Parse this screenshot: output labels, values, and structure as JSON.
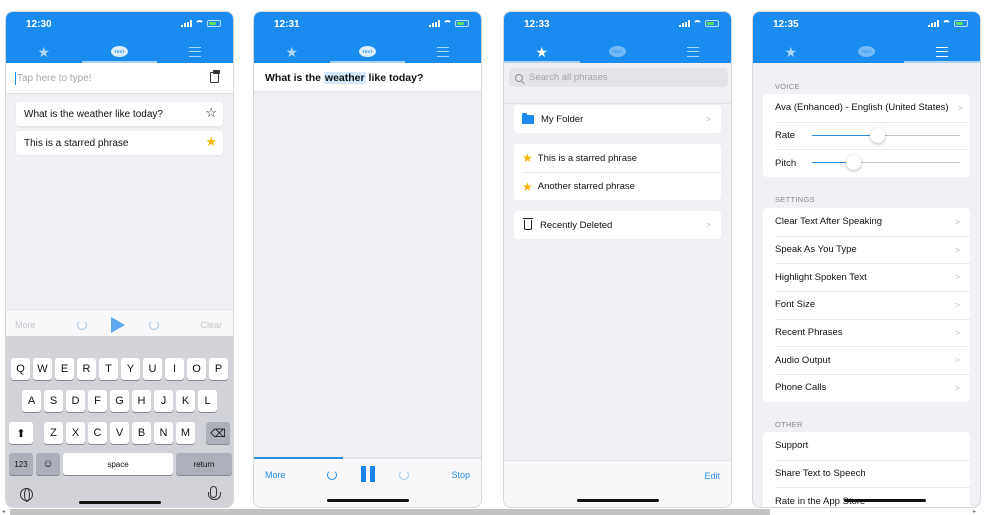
{
  "brand_color": "#1a8cf0",
  "screens": [
    {
      "time": "12:30",
      "active_tab": "text",
      "input_placeholder": "Tap here to type!",
      "phrases": [
        {
          "text": "What is the weather like today?",
          "starred": false
        },
        {
          "text": "This is a starred phrase",
          "starred": true
        }
      ],
      "controls": {
        "more": "More",
        "clear": "Clear"
      },
      "keyboard": {
        "row1": [
          "Q",
          "W",
          "E",
          "R",
          "T",
          "Y",
          "U",
          "I",
          "O",
          "P"
        ],
        "row2": [
          "A",
          "S",
          "D",
          "F",
          "G",
          "H",
          "J",
          "K",
          "L"
        ],
        "row3": [
          "Z",
          "X",
          "C",
          "V",
          "B",
          "N",
          "M"
        ],
        "num_key": "123",
        "space_key": "space",
        "return_key": "return"
      }
    },
    {
      "time": "12:31",
      "active_tab": "text",
      "speaking_text_before": "What is the ",
      "speaking_text_highlight": "weather",
      "speaking_text_after": " like today?",
      "progress": 0.39,
      "controls": {
        "more": "More",
        "stop": "Stop"
      }
    },
    {
      "time": "12:33",
      "active_tab": "starred",
      "search_placeholder": "Search all phrases",
      "folder": "My Folder",
      "starred_phrases": [
        "This is a starred phrase",
        "Another starred phrase"
      ],
      "recently_deleted": "Recently Deleted",
      "edit": "Edit"
    },
    {
      "time": "12:35",
      "active_tab": "settings",
      "voice_header": "VOICE",
      "voice_name": "Ava (Enhanced) - English (United States)",
      "rate_label": "Rate",
      "rate_value": 0.44,
      "pitch_label": "Pitch",
      "pitch_value": 0.28,
      "settings_header": "SETTINGS",
      "settings_items": [
        "Clear Text After Speaking",
        "Speak As You Type",
        "Highlight Spoken Text",
        "Font Size",
        "Recent Phrases",
        "Audio Output",
        "Phone Calls"
      ],
      "other_header": "OTHER",
      "other_items": [
        "Support",
        "Share Text to Speech",
        "Rate in the App Store"
      ]
    }
  ],
  "tab_icons": [
    "star-icon",
    "text-bubble-icon",
    "sliders-icon"
  ],
  "text_bubble_label": "TEXT",
  "chevron": ">",
  "star_filled": "★",
  "star_empty": "☆",
  "scrollbar": {
    "position": 0.0
  }
}
